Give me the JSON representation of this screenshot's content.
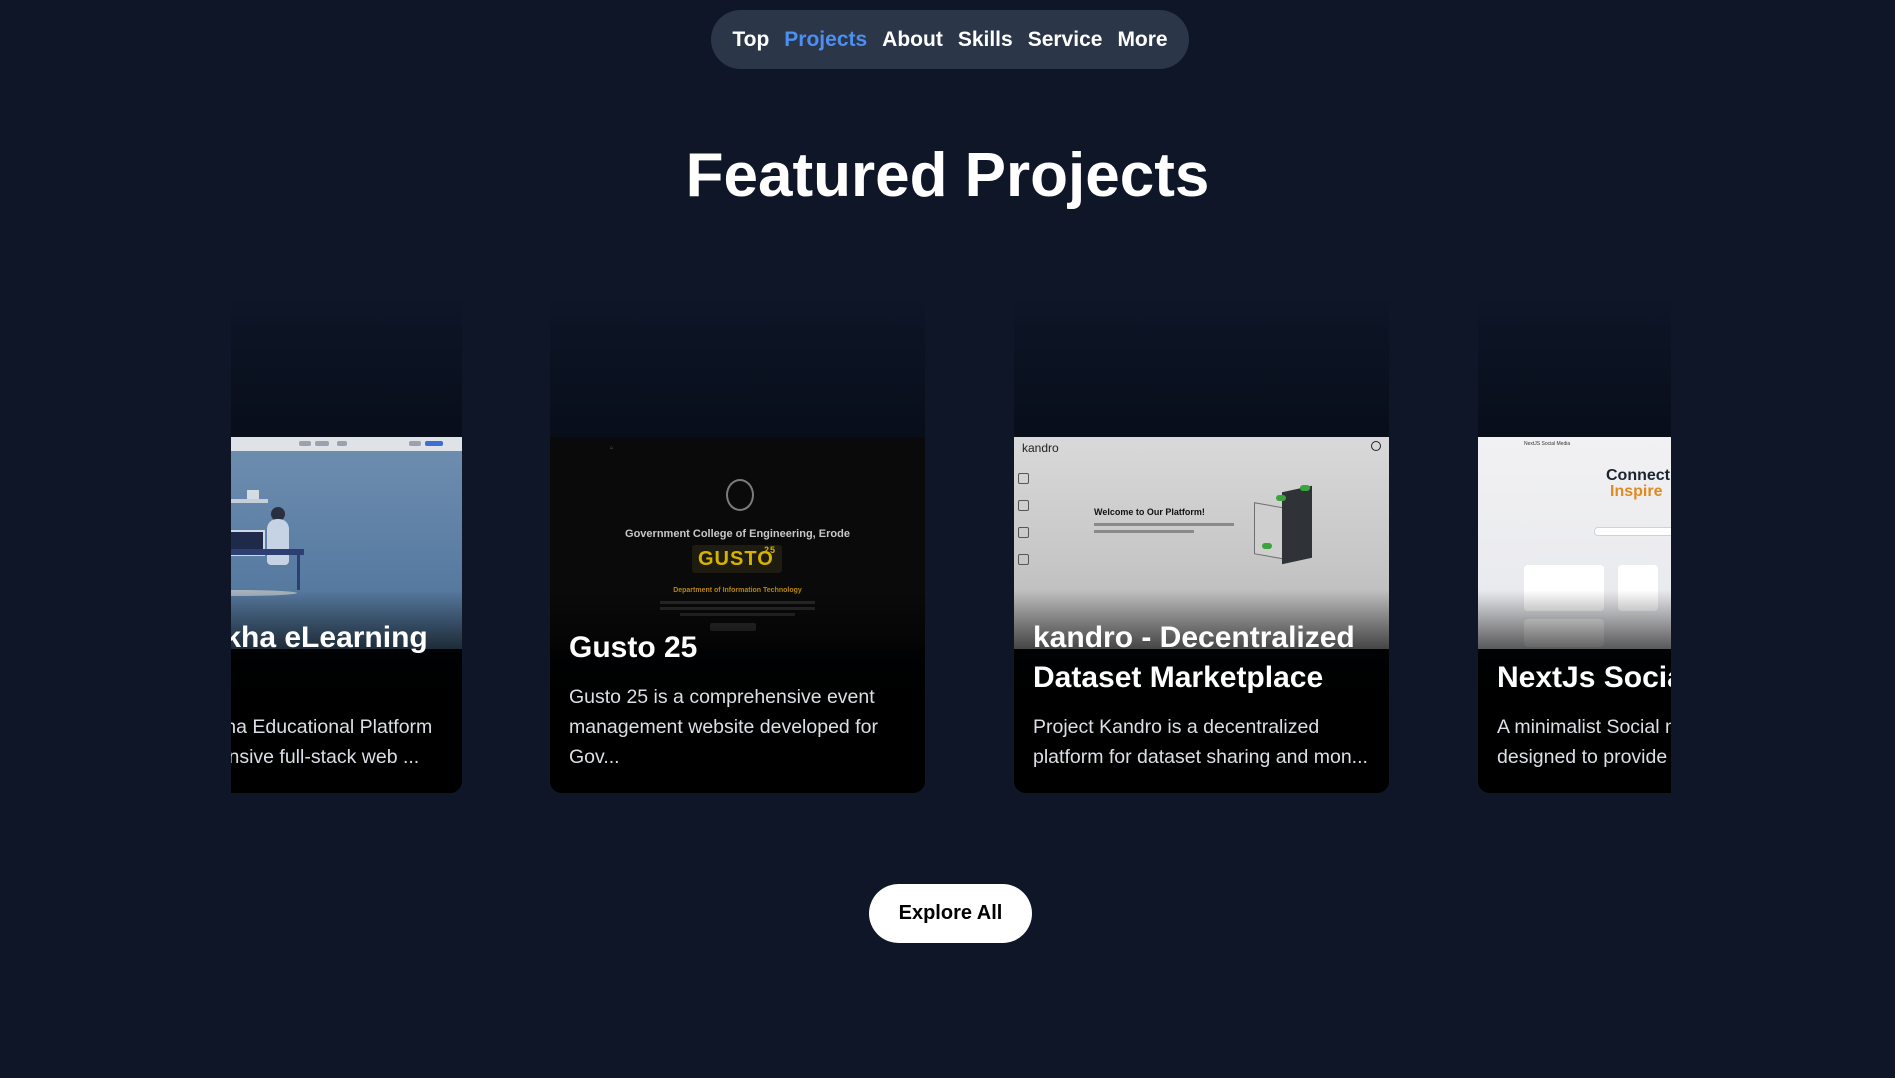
{
  "nav": {
    "items": [
      {
        "label": "Top"
      },
      {
        "label": "Projects",
        "active": true
      },
      {
        "label": "About"
      },
      {
        "label": "Skills"
      },
      {
        "label": "Service"
      },
      {
        "label": "More"
      }
    ],
    "active_color": "#4d8ff0"
  },
  "section": {
    "title": "Featured Projects"
  },
  "projects": [
    {
      "title": "Bodhasikha eLearning Platform",
      "description": "The Bodhasikha Educational Platform is a comprehensive full-stack web ..."
    },
    {
      "title": "Gusto 25",
      "description": "Gusto 25 is a comprehensive event management website developed for Gov...",
      "thumbnail_text": {
        "college": "Government College of Engineering, Erode",
        "logo": "GUSTO",
        "logo_sup": "25",
        "department": "Department of Information Technology"
      }
    },
    {
      "title": "kandro - Decentralized Dataset Marketplace",
      "description": "Project Kandro is a decentralized platform for dataset sharing and mon...",
      "thumbnail_text": {
        "brand": "kandro",
        "welcome": "Welcome to Our Platform!"
      }
    },
    {
      "title": "NextJs Social Media",
      "description": "A minimalist Social media platform designed to provide ...",
      "thumbnail_text": {
        "brand": "NextJS Social Media",
        "headline": "Connect and",
        "headline_accent": "Inspire"
      }
    }
  ],
  "cta": {
    "label": "Explore All"
  },
  "colors": {
    "background": "#0e1628",
    "nav_pill": "#2b3648",
    "accent": "#4d8ff0"
  }
}
